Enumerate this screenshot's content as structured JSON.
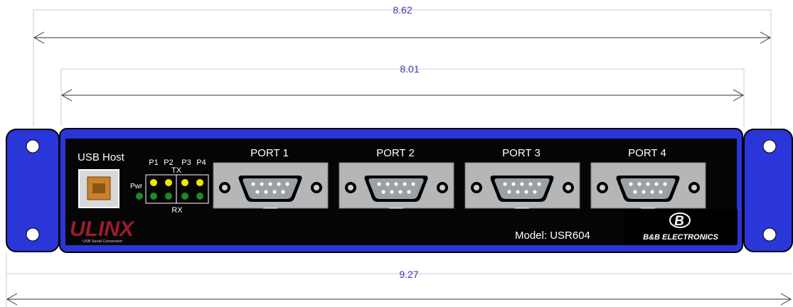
{
  "dimensions": {
    "overall_width": "8.62",
    "inner_width": "8.01",
    "total_width": "9.27"
  },
  "panel": {
    "usb_label": "USB Host",
    "pwr_label": "Pwr",
    "port_led_labels": [
      "P1",
      "P2",
      "P3",
      "P4"
    ],
    "tx_label": "TX",
    "rx_label": "RX",
    "ports": [
      "PORT 1",
      "PORT 2",
      "PORT 3",
      "PORT 4"
    ],
    "model": "Model: USR604",
    "logo_text": "ULINX",
    "logo_tagline": "USB Serial Conversion",
    "brand_mark": "B",
    "brand_name": "B&B ELECTRONICS"
  },
  "colors": {
    "panel_blue": "#2a36d8",
    "panel_black": "#050505",
    "dimension_text": "#3a3aa8",
    "led_yellow": "#f2e600",
    "led_green": "#1f8a1f",
    "connector_gray": "#b4b6b8",
    "usb_orange": "#c9822a",
    "logo_red": "#9b1c2c"
  }
}
